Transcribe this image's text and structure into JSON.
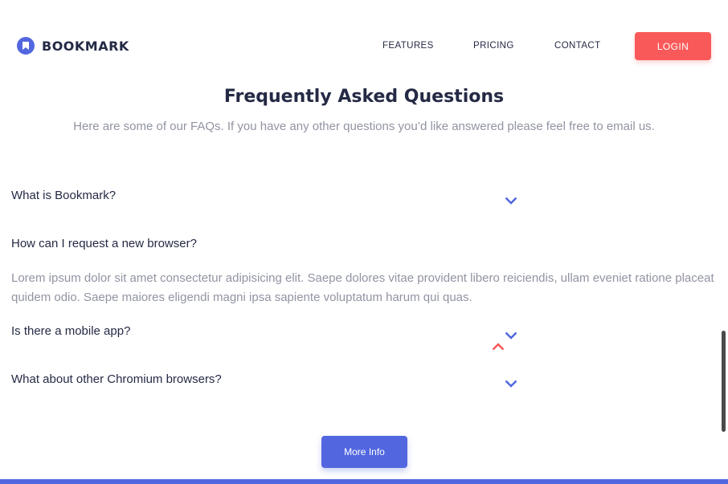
{
  "header": {
    "brand": "BOOKMARK",
    "nav": [
      "FEATURES",
      "PRICING",
      "CONTACT"
    ],
    "login_label": "LOGIN"
  },
  "faq": {
    "title": "Frequently Asked Questions",
    "subtitle": "Here are some of our FAQs. If you have any other questions you’d like answered please feel free to email us.",
    "questions": [
      "What is Bookmark?",
      "How can I request a new browser?",
      "Is there a mobile app?",
      "What about other Chromium browsers?"
    ],
    "answer": "Lorem ipsum dolor sit amet consectetur adipisicing elit. Saepe dolores vitae provident libero reiciendis, ullam eveniet ratione placeat quidem odio. Saepe maiores eligendi magni ipsa sapiente voluptatum harum qui quas.",
    "more_label": "More Info"
  },
  "colors": {
    "accent_blue": "#5267df",
    "accent_red": "#fa5959",
    "text_dark": "#242a45",
    "text_muted": "#9194a2"
  },
  "icons": {
    "brand": "bookmark-logo-icon",
    "expand": "chevron-down-icon",
    "collapse": "chevron-up-icon"
  }
}
